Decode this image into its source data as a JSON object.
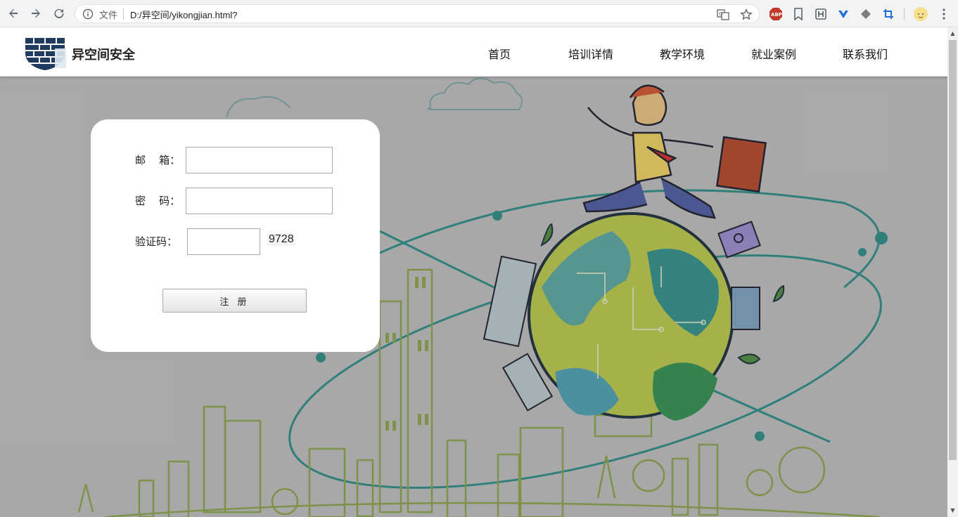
{
  "browser": {
    "file_label": "文件",
    "url": "D:/异空间/yikongjian.html?",
    "extensions": [
      "translate-icon",
      "star-icon",
      "adblock-icon",
      "bookmark-icon",
      "h-icon",
      "v-icon",
      "diamond-icon",
      "crop-icon",
      "profile-avatar"
    ],
    "abp_label": "ABP"
  },
  "site": {
    "brand": "异空间安全",
    "nav": [
      {
        "label": "首页"
      },
      {
        "label": "培训详情"
      },
      {
        "label": "教学环境"
      },
      {
        "label": "就业案例"
      },
      {
        "label": "联系我们"
      }
    ]
  },
  "form": {
    "email_label": "邮    箱：",
    "password_label": "密    码：",
    "captcha_label": "验证码：",
    "email_value": "",
    "password_value": "",
    "captcha_value": "",
    "captcha_code": "9728",
    "submit_label": "注 册"
  },
  "colors": {
    "accent_teal": "#2a9d8f",
    "logo_navy": "#1f3a5f",
    "earth_green": "#8dbb3c"
  }
}
